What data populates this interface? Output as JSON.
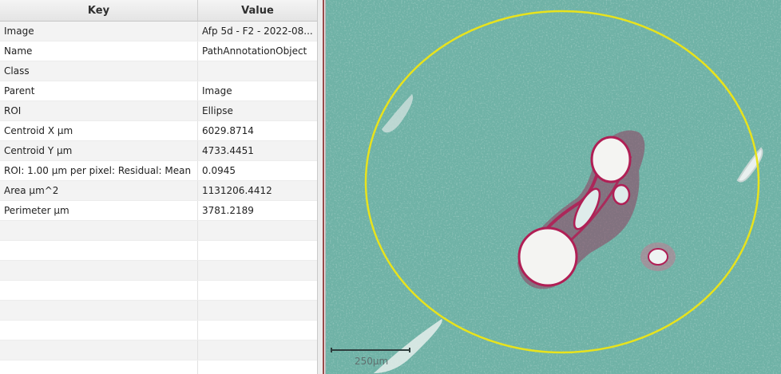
{
  "table": {
    "headers": {
      "key": "Key",
      "value": "Value"
    },
    "rows": [
      {
        "key": "Image",
        "value": "Afp 5d - F2 - 2022-08..."
      },
      {
        "key": "Name",
        "value": "PathAnnotationObject"
      },
      {
        "key": "Class",
        "value": ""
      },
      {
        "key": "Parent",
        "value": "Image"
      },
      {
        "key": "ROI",
        "value": "Ellipse"
      },
      {
        "key": "Centroid X µm",
        "value": "6029.8714"
      },
      {
        "key": "Centroid Y µm",
        "value": "4733.4451"
      },
      {
        "key": "ROI: 1.00 µm per pixel: Residual: Mean",
        "value": "0.0945"
      },
      {
        "key": "Area µm^2",
        "value": "1131206.4412"
      },
      {
        "key": "Perimeter µm",
        "value": "3781.2189"
      }
    ]
  },
  "viewer": {
    "scalebar_label": "250µm",
    "annotation_color": "#e8e31c",
    "tissue_color": "#6fb2a6",
    "stain_color": "#b01f55"
  }
}
